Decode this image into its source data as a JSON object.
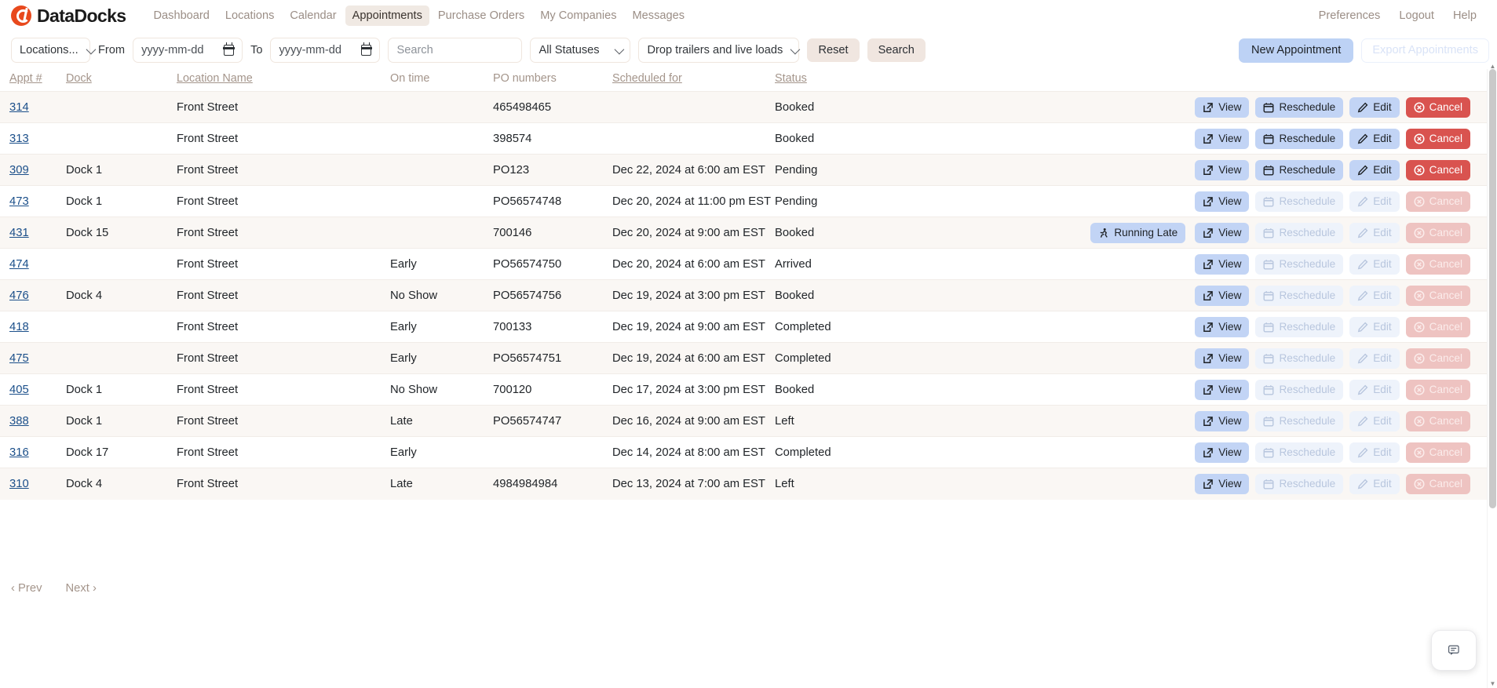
{
  "brand": {
    "name": "DataDocks",
    "logo_color": "#e8491d"
  },
  "nav": {
    "items": [
      {
        "label": "Dashboard",
        "active": false
      },
      {
        "label": "Locations",
        "active": false
      },
      {
        "label": "Calendar",
        "active": false
      },
      {
        "label": "Appointments",
        "active": true
      },
      {
        "label": "Purchase Orders",
        "active": false
      },
      {
        "label": "My Companies",
        "active": false
      },
      {
        "label": "Messages",
        "active": false
      }
    ],
    "right": [
      {
        "label": "Preferences"
      },
      {
        "label": "Logout"
      },
      {
        "label": "Help"
      }
    ]
  },
  "toolbar": {
    "locations_select": "Locations...",
    "from_label": "From",
    "from_placeholder": "yyyy-mm-dd",
    "from_value": "",
    "to_label": "To",
    "to_placeholder": "yyyy-mm-dd",
    "to_value": "",
    "search_placeholder": "Search",
    "search_value": "",
    "status_select": "All Statuses",
    "type_select": "Drop trailers and live loads",
    "reset_label": "Reset",
    "search_label": "Search",
    "new_appointment_label": "New Appointment",
    "export_label": "Export Appointments",
    "primary_color": "#bdd2f5"
  },
  "table": {
    "columns": [
      {
        "label": "Appt #",
        "sortable": true
      },
      {
        "label": "Dock",
        "sortable": true
      },
      {
        "label": "Location Name",
        "sortable": true
      },
      {
        "label": "On time",
        "sortable": false
      },
      {
        "label": "PO numbers",
        "sortable": false
      },
      {
        "label": "Scheduled for",
        "sortable": true
      },
      {
        "label": "Status",
        "sortable": true
      }
    ],
    "actions": {
      "view": "View",
      "reschedule": "Reschedule",
      "edit": "Edit",
      "cancel": "Cancel",
      "running_late": "Running Late"
    },
    "rows": [
      {
        "appt": "314",
        "dock": "",
        "location": "Front Street",
        "ontime": "",
        "po": "465498465",
        "scheduled": "",
        "status": "Booked",
        "running_late": false,
        "enabled": {
          "view": true,
          "reschedule": true,
          "edit": true,
          "cancel": true
        }
      },
      {
        "appt": "313",
        "dock": "",
        "location": "Front Street",
        "ontime": "",
        "po": "398574",
        "scheduled": "",
        "status": "Booked",
        "running_late": false,
        "enabled": {
          "view": true,
          "reschedule": true,
          "edit": true,
          "cancel": true
        }
      },
      {
        "appt": "309",
        "dock": "Dock 1",
        "location": "Front Street",
        "ontime": "",
        "po": "PO123",
        "scheduled": "Dec 22, 2024 at 6:00 am EST",
        "status": "Pending",
        "running_late": false,
        "enabled": {
          "view": true,
          "reschedule": true,
          "edit": true,
          "cancel": true
        }
      },
      {
        "appt": "473",
        "dock": "Dock 1",
        "location": "Front Street",
        "ontime": "",
        "po": "PO56574748",
        "scheduled": "Dec 20, 2024 at 11:00 pm EST",
        "status": "Pending",
        "running_late": false,
        "enabled": {
          "view": true,
          "reschedule": false,
          "edit": false,
          "cancel": false
        }
      },
      {
        "appt": "431",
        "dock": "Dock 15",
        "location": "Front Street",
        "ontime": "",
        "po": "700146",
        "scheduled": "Dec 20, 2024 at 9:00 am EST",
        "status": "Booked",
        "running_late": true,
        "enabled": {
          "view": true,
          "reschedule": false,
          "edit": false,
          "cancel": false
        }
      },
      {
        "appt": "474",
        "dock": "",
        "location": "Front Street",
        "ontime": "Early",
        "po": "PO56574750",
        "scheduled": "Dec 20, 2024 at 6:00 am EST",
        "status": "Arrived",
        "running_late": false,
        "enabled": {
          "view": true,
          "reschedule": false,
          "edit": false,
          "cancel": false
        }
      },
      {
        "appt": "476",
        "dock": "Dock 4",
        "location": "Front Street",
        "ontime": "No Show",
        "po": "PO56574756",
        "scheduled": "Dec 19, 2024 at 3:00 pm EST",
        "status": "Booked",
        "running_late": false,
        "enabled": {
          "view": true,
          "reschedule": false,
          "edit": false,
          "cancel": false
        }
      },
      {
        "appt": "418",
        "dock": "",
        "location": "Front Street",
        "ontime": "Early",
        "po": "700133",
        "scheduled": "Dec 19, 2024 at 9:00 am EST",
        "status": "Completed",
        "running_late": false,
        "enabled": {
          "view": true,
          "reschedule": false,
          "edit": false,
          "cancel": false
        }
      },
      {
        "appt": "475",
        "dock": "",
        "location": "Front Street",
        "ontime": "Early",
        "po": "PO56574751",
        "scheduled": "Dec 19, 2024 at 6:00 am EST",
        "status": "Completed",
        "running_late": false,
        "enabled": {
          "view": true,
          "reschedule": false,
          "edit": false,
          "cancel": false
        }
      },
      {
        "appt": "405",
        "dock": "Dock 1",
        "location": "Front Street",
        "ontime": "No Show",
        "po": "700120",
        "scheduled": "Dec 17, 2024 at 3:00 pm EST",
        "status": "Booked",
        "running_late": false,
        "enabled": {
          "view": true,
          "reschedule": false,
          "edit": false,
          "cancel": false
        }
      },
      {
        "appt": "388",
        "dock": "Dock 1",
        "location": "Front Street",
        "ontime": "Late",
        "po": "PO56574747",
        "scheduled": "Dec 16, 2024 at 9:00 am EST",
        "status": "Left",
        "running_late": false,
        "enabled": {
          "view": true,
          "reschedule": false,
          "edit": false,
          "cancel": false
        }
      },
      {
        "appt": "316",
        "dock": "Dock 17",
        "location": "Front Street",
        "ontime": "Early",
        "po": "",
        "scheduled": "Dec 14, 2024 at 8:00 am EST",
        "status": "Completed",
        "running_late": false,
        "enabled": {
          "view": true,
          "reschedule": false,
          "edit": false,
          "cancel": false
        }
      },
      {
        "appt": "310",
        "dock": "Dock 4",
        "location": "Front Street",
        "ontime": "Late",
        "po": "4984984984",
        "scheduled": "Dec 13, 2024 at 7:00 am EST",
        "status": "Left",
        "running_late": false,
        "enabled": {
          "view": true,
          "reschedule": false,
          "edit": false,
          "cancel": false
        }
      }
    ]
  },
  "pagination": {
    "prev": "‹ Prev",
    "next": "Next ›"
  },
  "chat": {
    "icon": "chat-icon"
  }
}
